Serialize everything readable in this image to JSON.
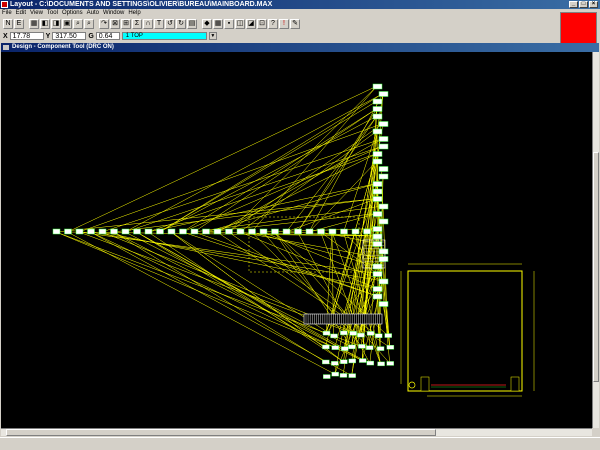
{
  "window": {
    "title": "Layout - C:\\DOCUMENTS AND SETTINGS\\OLIVIER\\BUREAU\\MAINBOARD.MAX"
  },
  "menu": [
    "File",
    "Edit",
    "View",
    "Tool",
    "Options",
    "Auto",
    "Window",
    "Help"
  ],
  "toolbar": {
    "buttons": [
      "N",
      "E",
      "▦",
      "◧",
      "◨",
      "▣",
      "⌕",
      "⌕",
      "↷",
      "⊠",
      "⊞",
      "Σ",
      "∩",
      "T",
      "↺",
      "↻",
      "▤",
      "◆",
      "▦",
      "▪",
      "◫",
      "◪",
      "⊡",
      "?",
      "!",
      "✎"
    ]
  },
  "coords": {
    "x_label": "X",
    "x_value": "17.78",
    "y_label": "Y",
    "y_value": "317.50",
    "g_label": "G",
    "g_value": "0.64",
    "layer_value": "1 TOP"
  },
  "child_window": {
    "title": "Design - Component Tool (DRC ON)"
  },
  "colors": {
    "canvas": "#000000",
    "ratsnest": "#ffff00",
    "layer": "#00ffff",
    "indicator": "#ff0000"
  }
}
